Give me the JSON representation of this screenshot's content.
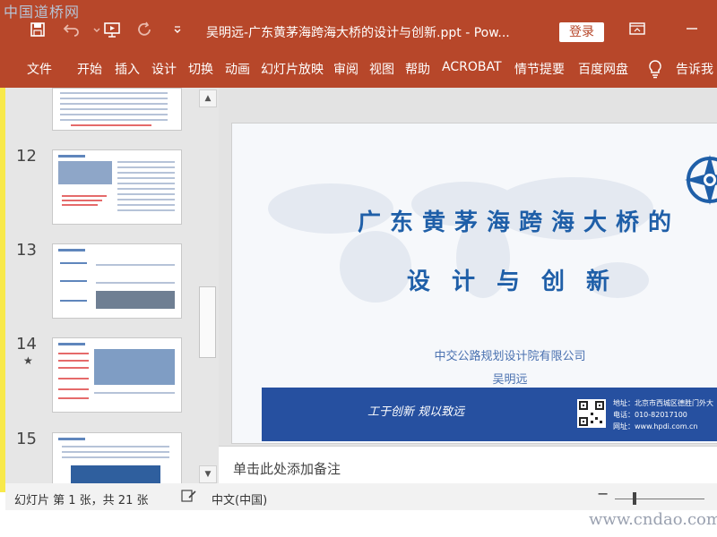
{
  "app": {
    "document_title": "吴明远-广东黄茅海跨海大桥的设计与创新.ppt  -  Pow...",
    "login_label": "登录",
    "watermark_top": "中国道桥网",
    "watermark_bottom": "www.cndao.com"
  },
  "quick_access": [
    {
      "name": "save",
      "icon": "save-icon"
    },
    {
      "name": "undo",
      "icon": "undo-icon"
    },
    {
      "name": "present",
      "icon": "present-icon"
    },
    {
      "name": "redo",
      "icon": "redo-icon"
    },
    {
      "name": "customize",
      "icon": "chevron-down-icon"
    }
  ],
  "ribbon_tabs": [
    "文件",
    "开始",
    "插入",
    "设计",
    "切换",
    "动画",
    "幻灯片放映",
    "审阅",
    "视图",
    "帮助",
    "ACROBAT",
    "情节提要",
    "百度网盘",
    "告诉我"
  ],
  "slides": [
    {
      "number": "12",
      "starred": false
    },
    {
      "number": "13",
      "starred": false
    },
    {
      "number": "14",
      "starred": true,
      "star_glyph": "★"
    },
    {
      "number": "15",
      "starred": false
    }
  ],
  "current_slide": {
    "title_line1": "广东黄茅海跨海大桥的",
    "title_line2": "设计与创新",
    "company": "中交公路规划设计院有限公司",
    "author": "吴明远",
    "slogan": "工于创新  规以致远",
    "address": "地址：北京市西城区德胜门外大",
    "phone": "电话：010-82017100",
    "website": "网址：www.hpdi.com.cn"
  },
  "notes_placeholder": "单击此处添加备注",
  "status": {
    "slide_info": "幻灯片 第 1 张，共 21 张",
    "language": "中文(中国)"
  },
  "colors": {
    "accent": "#b7472a",
    "title_blue": "#1f5fa8",
    "band_blue": "#2650a0"
  }
}
